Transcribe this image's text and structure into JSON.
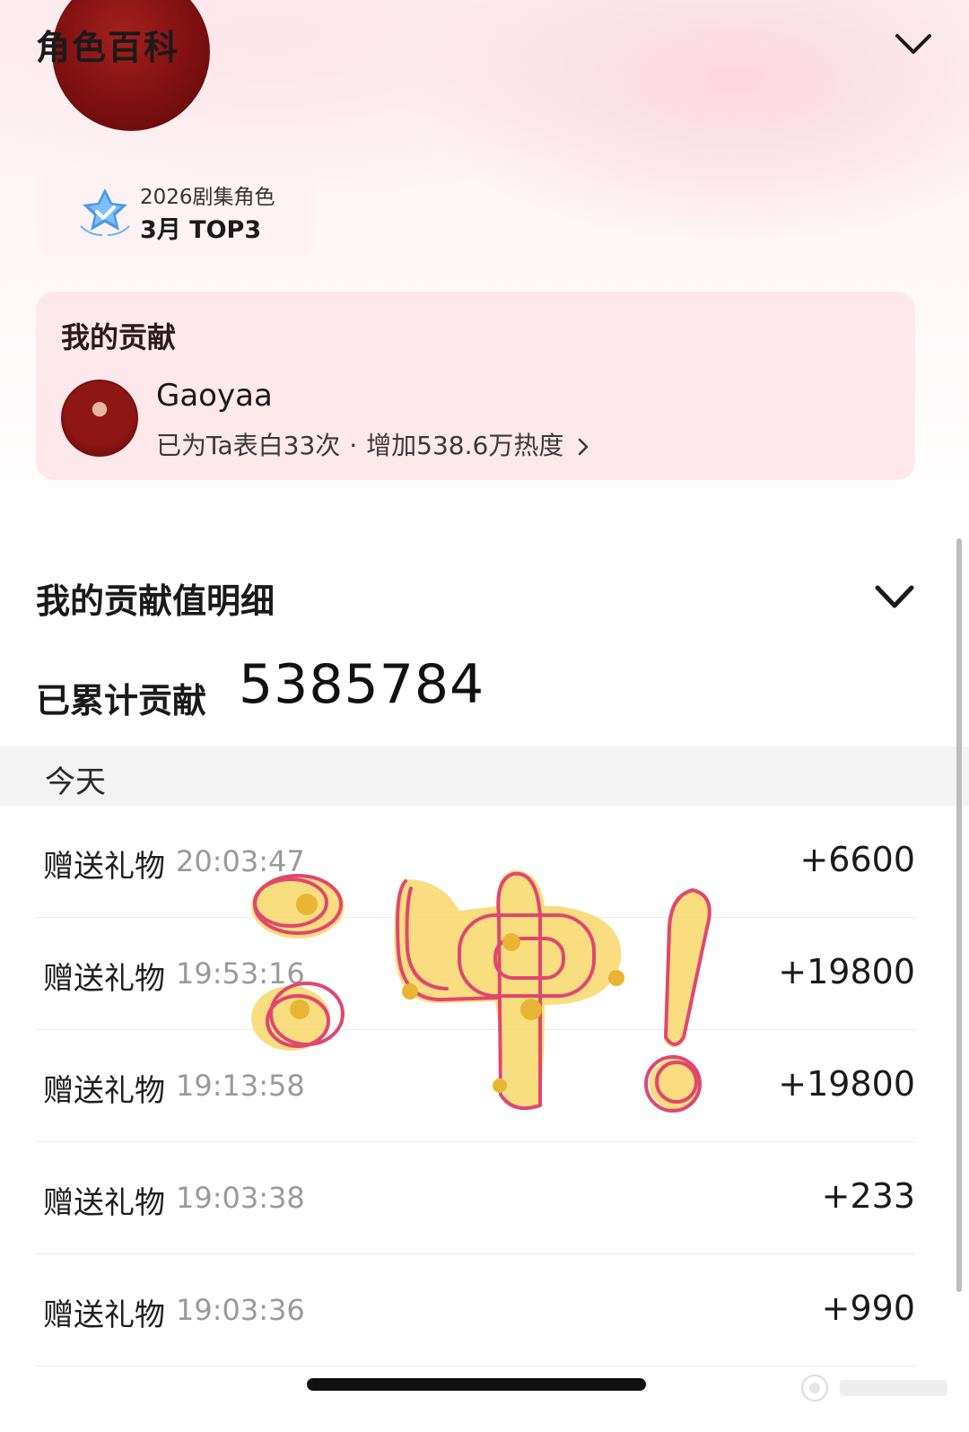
{
  "header": {
    "title": "角色百科"
  },
  "rank": {
    "line1": "2026剧集角色",
    "line2": "3月 TOP3"
  },
  "contribution": {
    "title": "我的贡献",
    "user_name": "Gaoyaa",
    "confess_text": "已为Ta表白33次",
    "separator": "·",
    "heat_text": "增加538.6万热度"
  },
  "detail": {
    "title": "我的贡献值明细",
    "total_label": "已累计贡献",
    "total_value": "5385784"
  },
  "day_label": "今天",
  "records": [
    {
      "type": "赠送礼物",
      "time": "20:03:47",
      "amount": "+6600"
    },
    {
      "type": "赠送礼物",
      "time": "19:53:16",
      "amount": "+19800"
    },
    {
      "type": "赠送礼物",
      "time": "19:13:58",
      "amount": "+19800"
    },
    {
      "type": "赠送礼物",
      "time": "19:03:38",
      "amount": "+233"
    },
    {
      "type": "赠送礼物",
      "time": "19:03:36",
      "amount": "+990"
    }
  ],
  "colors": {
    "card_bg": "#fde8ec",
    "avatar_red": "#8e1614",
    "sticker_yellow": "#f8d86a",
    "sticker_outline": "#e0476f"
  }
}
